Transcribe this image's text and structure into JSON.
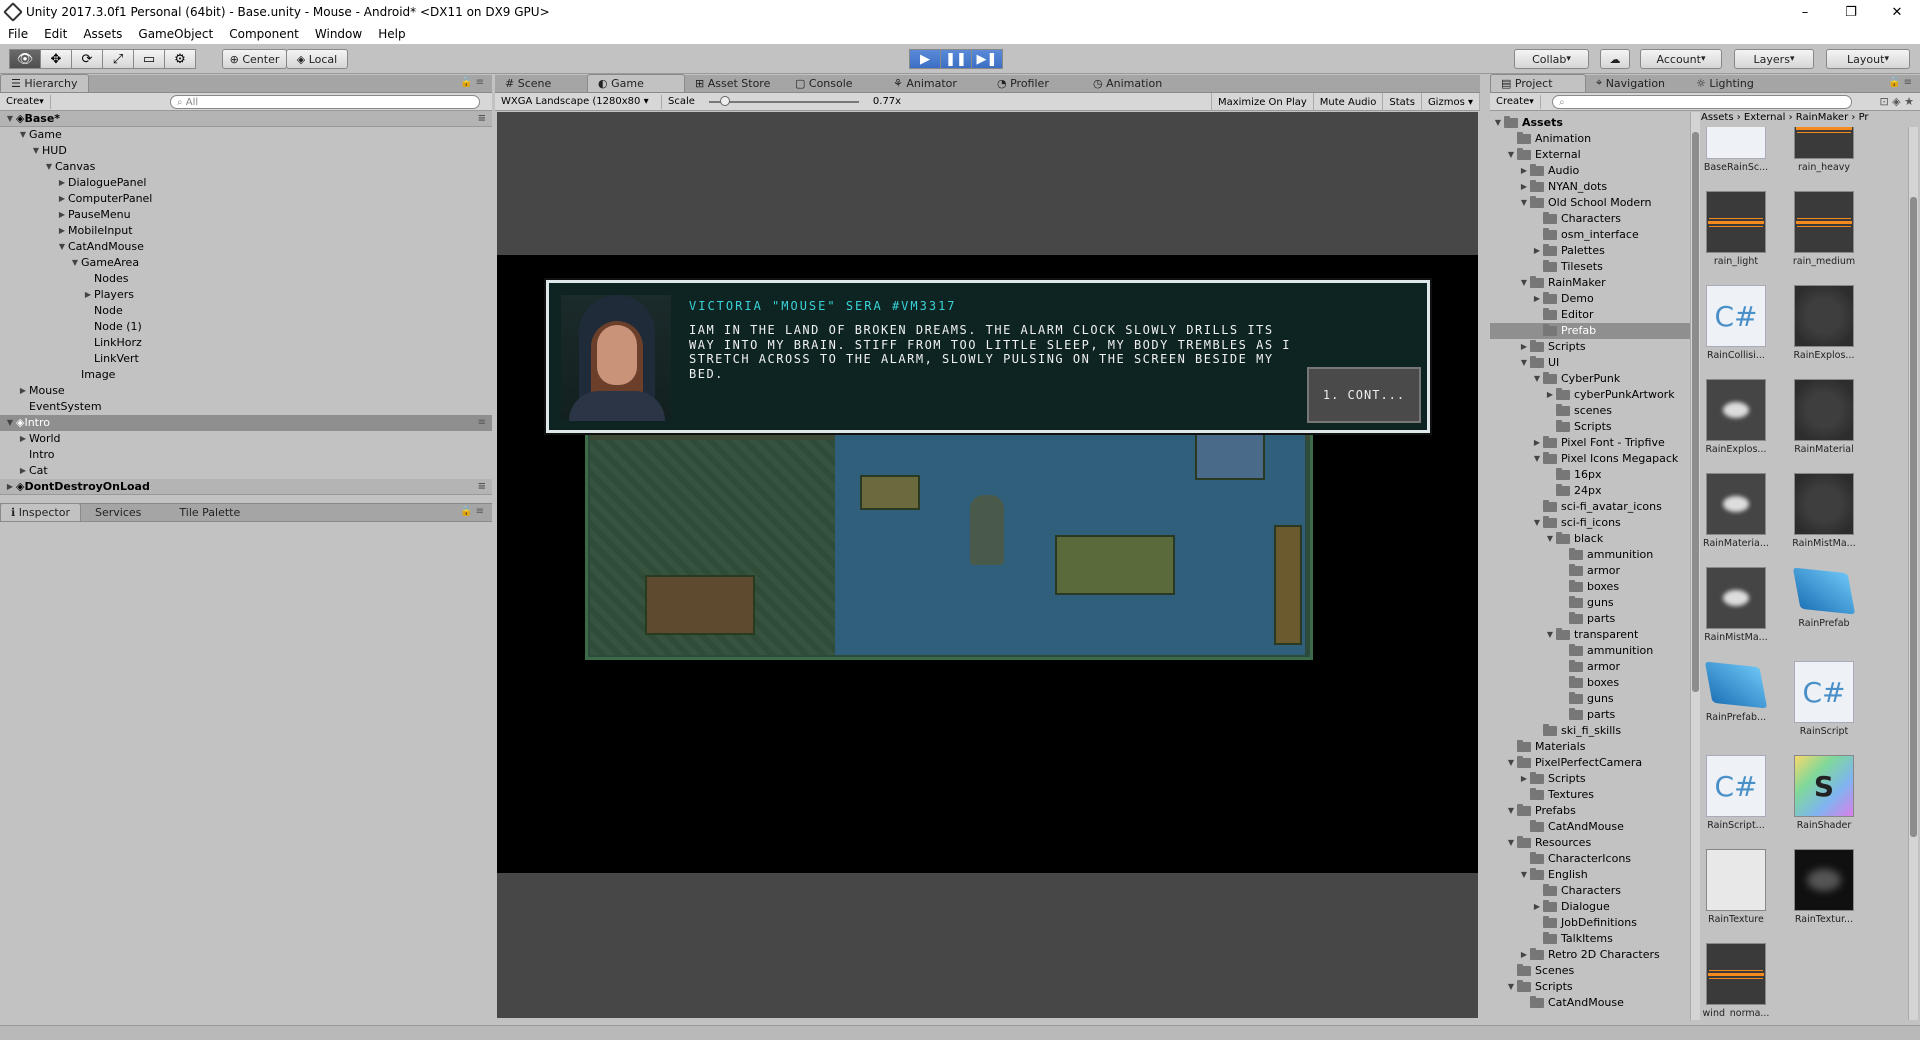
{
  "window": {
    "title": "Unity 2017.3.0f1 Personal (64bit) - Base.unity - Mouse - Android* <DX11 on DX9 GPU>",
    "minimize": "–",
    "maximize": "❐",
    "close": "✕"
  },
  "menu": [
    "File",
    "Edit",
    "Assets",
    "GameObject",
    "Component",
    "Window",
    "Help"
  ],
  "toolbar": {
    "pivot": "Center",
    "space": "Local",
    "collab": "Collab",
    "account": "Account",
    "layers": "Layers",
    "layout": "Layout",
    "cloud": "☁",
    "tools": [
      "👁",
      "✥",
      "⟳",
      "⤢",
      "▭",
      "⚙"
    ],
    "play": [
      "▶",
      "❚❚",
      "▶❚"
    ]
  },
  "hierarchy": {
    "tab": "Hierarchy",
    "create": "Create",
    "search_placeholder": "All",
    "rows": [
      {
        "label": "Base*",
        "indent": 0,
        "arrow": "▼",
        "kind": "scene"
      },
      {
        "label": "Game",
        "indent": 1,
        "arrow": "▼"
      },
      {
        "label": "HUD",
        "indent": 2,
        "arrow": "▼"
      },
      {
        "label": "Canvas",
        "indent": 3,
        "arrow": "▼"
      },
      {
        "label": "DialoguePanel",
        "indent": 4,
        "arrow": "▶"
      },
      {
        "label": "ComputerPanel",
        "indent": 4,
        "arrow": "▶"
      },
      {
        "label": "PauseMenu",
        "indent": 4,
        "arrow": "▶"
      },
      {
        "label": "MobileInput",
        "indent": 4,
        "arrow": "▶"
      },
      {
        "label": "CatAndMouse",
        "indent": 4,
        "arrow": "▼"
      },
      {
        "label": "GameArea",
        "indent": 5,
        "arrow": "▼"
      },
      {
        "label": "Nodes",
        "indent": 6,
        "arrow": ""
      },
      {
        "label": "Players",
        "indent": 6,
        "arrow": "▶"
      },
      {
        "label": "Node",
        "indent": 6,
        "arrow": ""
      },
      {
        "label": "Node (1)",
        "indent": 6,
        "arrow": ""
      },
      {
        "label": "LinkHorz",
        "indent": 6,
        "arrow": ""
      },
      {
        "label": "LinkVert",
        "indent": 6,
        "arrow": ""
      },
      {
        "label": "Image",
        "indent": 5,
        "arrow": ""
      },
      {
        "label": "Mouse",
        "indent": 1,
        "arrow": "▶"
      },
      {
        "label": "EventSystem",
        "indent": 1,
        "arrow": ""
      },
      {
        "label": "Intro",
        "indent": 0,
        "arrow": "▼",
        "kind": "scene-sel"
      },
      {
        "label": "World",
        "indent": 1,
        "arrow": "▶"
      },
      {
        "label": "Intro",
        "indent": 1,
        "arrow": ""
      },
      {
        "label": "Cat",
        "indent": 1,
        "arrow": "▶"
      },
      {
        "label": "DontDestroyOnLoad",
        "indent": 0,
        "arrow": "▶",
        "kind": "scene"
      }
    ]
  },
  "inspector": {
    "tabs": [
      "Inspector",
      "Services",
      "Tile Palette"
    ]
  },
  "center": {
    "tabs": [
      "Scene",
      "Game",
      "Asset Store",
      "Console",
      "Animator",
      "Profiler",
      "Animation"
    ],
    "active_tab": "Game",
    "resolution": "WXGA Landscape (1280x80",
    "scale_label": "Scale",
    "scale_value": "0.77x",
    "options": [
      "Maximize On Play",
      "Mute Audio",
      "Stats",
      "Gizmos"
    ],
    "slider_level": 0.08
  },
  "dialogue": {
    "name": "VICTORIA \"MOUSE\" SERA #VM3317",
    "text": "IAM IN THE LAND OF BROKEN DREAMS. THE ALARM CLOCK SLOWLY DRILLS ITS WAY INTO MY BRAIN. STIFF FROM TOO LITTLE SLEEP, MY BODY TREMBLES AS I STRETCH ACROSS TO THE ALARM, SLOWLY PULSING ON THE SCREEN BESIDE MY BED.",
    "continue": "1. CONT..."
  },
  "project": {
    "tabs": [
      "Project",
      "Navigation",
      "Lighting"
    ],
    "create": "Create",
    "breadcrumb": [
      "Assets",
      "External",
      "RainMaker",
      "Pr"
    ],
    "tree": [
      {
        "label": "Assets",
        "indent": 0,
        "arrow": "▼",
        "bold": true
      },
      {
        "label": "Animation",
        "indent": 1,
        "arrow": ""
      },
      {
        "label": "External",
        "indent": 1,
        "arrow": "▼"
      },
      {
        "label": "Audio",
        "indent": 2,
        "arrow": "▶"
      },
      {
        "label": "NYAN_dots",
        "indent": 2,
        "arrow": "▶"
      },
      {
        "label": "Old School Modern",
        "indent": 2,
        "arrow": "▼"
      },
      {
        "label": "Characters",
        "indent": 3,
        "arrow": ""
      },
      {
        "label": "osm_interface",
        "indent": 3,
        "arrow": ""
      },
      {
        "label": "Palettes",
        "indent": 3,
        "arrow": "▶"
      },
      {
        "label": "Tilesets",
        "indent": 3,
        "arrow": ""
      },
      {
        "label": "RainMaker",
        "indent": 2,
        "arrow": "▼"
      },
      {
        "label": "Demo",
        "indent": 3,
        "arrow": "▶"
      },
      {
        "label": "Editor",
        "indent": 3,
        "arrow": ""
      },
      {
        "label": "Prefab",
        "indent": 3,
        "arrow": "",
        "sel": true
      },
      {
        "label": "Scripts",
        "indent": 2,
        "arrow": "▶"
      },
      {
        "label": "UI",
        "indent": 2,
        "arrow": "▼"
      },
      {
        "label": "CyberPunk",
        "indent": 3,
        "arrow": "▼"
      },
      {
        "label": "cyberPunkArtwork",
        "indent": 4,
        "arrow": "▶"
      },
      {
        "label": "scenes",
        "indent": 4,
        "arrow": ""
      },
      {
        "label": "Scripts",
        "indent": 4,
        "arrow": ""
      },
      {
        "label": "Pixel Font - Tripfive",
        "indent": 3,
        "arrow": "▶"
      },
      {
        "label": "Pixel Icons Megapack",
        "indent": 3,
        "arrow": "▼"
      },
      {
        "label": "16px",
        "indent": 4,
        "arrow": ""
      },
      {
        "label": "24px",
        "indent": 4,
        "arrow": ""
      },
      {
        "label": "sci-fi_avatar_icons",
        "indent": 3,
        "arrow": ""
      },
      {
        "label": "sci-fi_icons",
        "indent": 3,
        "arrow": "▼"
      },
      {
        "label": "black",
        "indent": 4,
        "arrow": "▼"
      },
      {
        "label": "ammunition",
        "indent": 5,
        "arrow": ""
      },
      {
        "label": "armor",
        "indent": 5,
        "arrow": ""
      },
      {
        "label": "boxes",
        "indent": 5,
        "arrow": ""
      },
      {
        "label": "guns",
        "indent": 5,
        "arrow": ""
      },
      {
        "label": "parts",
        "indent": 5,
        "arrow": ""
      },
      {
        "label": "transparent",
        "indent": 4,
        "arrow": "▼"
      },
      {
        "label": "ammunition",
        "indent": 5,
        "arrow": ""
      },
      {
        "label": "armor",
        "indent": 5,
        "arrow": ""
      },
      {
        "label": "boxes",
        "indent": 5,
        "arrow": ""
      },
      {
        "label": "guns",
        "indent": 5,
        "arrow": ""
      },
      {
        "label": "parts",
        "indent": 5,
        "arrow": ""
      },
      {
        "label": "ski_fi_skills",
        "indent": 3,
        "arrow": ""
      },
      {
        "label": "Materials",
        "indent": 1,
        "arrow": ""
      },
      {
        "label": "PixelPerfectCamera",
        "indent": 1,
        "arrow": "▼"
      },
      {
        "label": "Scripts",
        "indent": 2,
        "arrow": "▶"
      },
      {
        "label": "Textures",
        "indent": 2,
        "arrow": ""
      },
      {
        "label": "Prefabs",
        "indent": 1,
        "arrow": "▼"
      },
      {
        "label": "CatAndMouse",
        "indent": 2,
        "arrow": ""
      },
      {
        "label": "Resources",
        "indent": 1,
        "arrow": "▼"
      },
      {
        "label": "CharacterIcons",
        "indent": 2,
        "arrow": ""
      },
      {
        "label": "English",
        "indent": 2,
        "arrow": "▼"
      },
      {
        "label": "Characters",
        "indent": 3,
        "arrow": ""
      },
      {
        "label": "Dialogue",
        "indent": 3,
        "arrow": "▶"
      },
      {
        "label": "JobDefinitions",
        "indent": 3,
        "arrow": ""
      },
      {
        "label": "TalkItems",
        "indent": 3,
        "arrow": ""
      },
      {
        "label": "Retro 2D Characters",
        "indent": 2,
        "arrow": "▶"
      },
      {
        "label": "Scenes",
        "indent": 1,
        "arrow": ""
      },
      {
        "label": "Scripts",
        "indent": 1,
        "arrow": "▼"
      },
      {
        "label": "CatAndMouse",
        "indent": 2,
        "arrow": ""
      }
    ],
    "assets": [
      {
        "name": "BaseRainSc...",
        "kind": "doc-top"
      },
      {
        "name": "rain_heavy",
        "kind": "wave-top"
      },
      {
        "name": "rain_light",
        "kind": "wave"
      },
      {
        "name": "rain_medium",
        "kind": "wave"
      },
      {
        "name": "RainCollisi...",
        "kind": "doc",
        "glyph": "C#"
      },
      {
        "name": "RainExplos...",
        "kind": "mat"
      },
      {
        "name": "RainExplos...",
        "kind": "cloud"
      },
      {
        "name": "RainMaterial",
        "kind": "mat"
      },
      {
        "name": "RainMateria...",
        "kind": "cloud"
      },
      {
        "name": "RainMistMa...",
        "kind": "mat"
      },
      {
        "name": "RainMistMa...",
        "kind": "cloud"
      },
      {
        "name": "RainPrefab",
        "kind": "cube"
      },
      {
        "name": "RainPrefab...",
        "kind": "cube"
      },
      {
        "name": "RainScript",
        "kind": "doc",
        "glyph": "C#"
      },
      {
        "name": "RainScript...",
        "kind": "doc",
        "glyph": "C#"
      },
      {
        "name": "RainShader",
        "kind": "shader",
        "glyph": "S"
      },
      {
        "name": "RainTexture",
        "kind": "tex"
      },
      {
        "name": "RainTextur...",
        "kind": "texd"
      },
      {
        "name": "wind_norma...",
        "kind": "wave"
      }
    ]
  }
}
